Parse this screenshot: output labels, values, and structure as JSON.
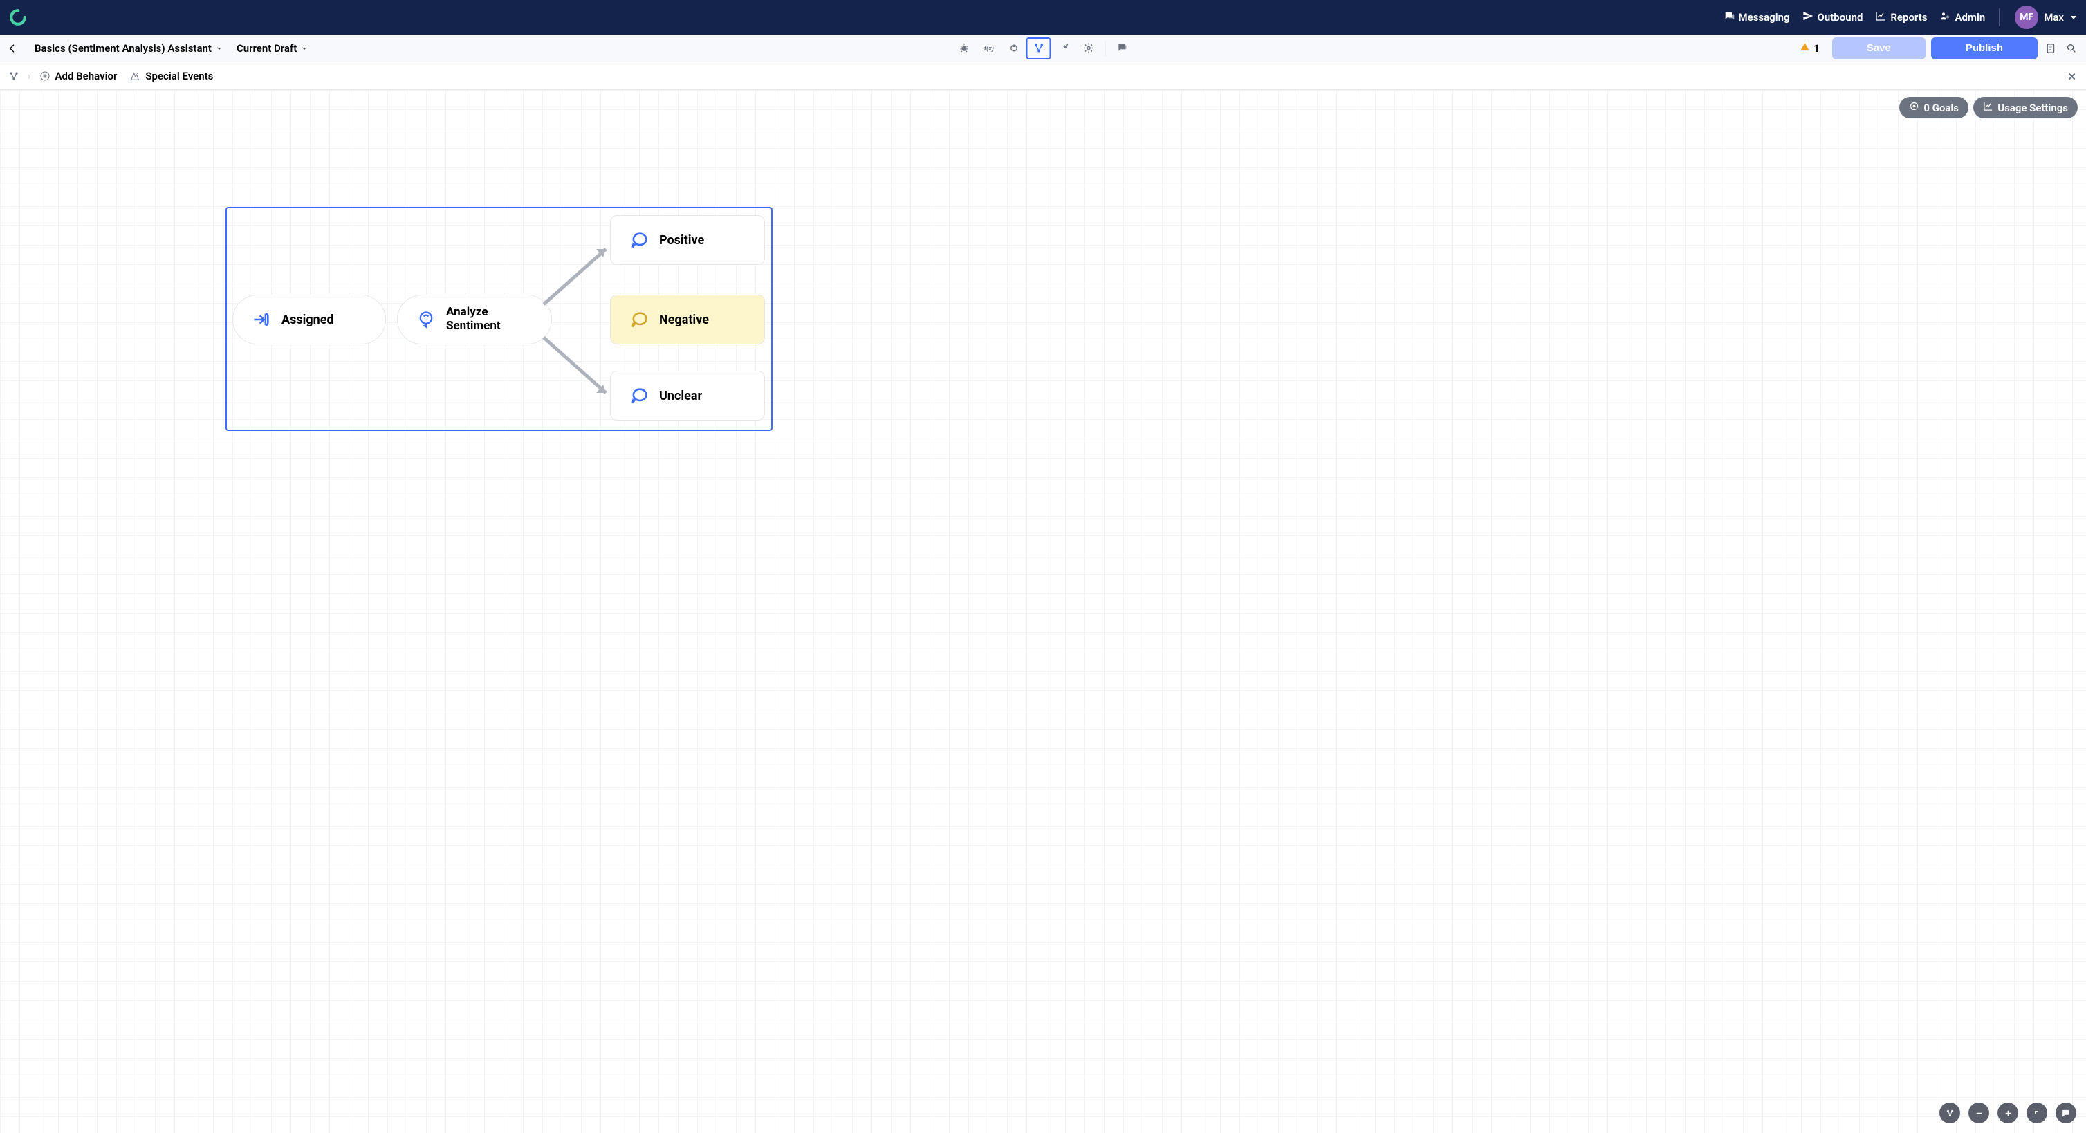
{
  "nav": {
    "messaging": "Messaging",
    "outbound": "Outbound",
    "reports": "Reports",
    "admin": "Admin",
    "user_initials": "MF",
    "user_name": "Max"
  },
  "breadcrumb": {
    "assistant": "Basics (Sentiment Analysis) Assistant",
    "draft": "Current Draft"
  },
  "toolbar": {
    "warnings": "1",
    "save": "Save",
    "publish": "Publish"
  },
  "strip": {
    "add_behavior": "Add Behavior",
    "special_events": "Special Events"
  },
  "canvas": {
    "goals_pill": "0 Goals",
    "usage_pill": "Usage Settings"
  },
  "nodes": {
    "assigned": "Assigned",
    "analyze_l1": "Analyze",
    "analyze_l2": "Sentiment",
    "positive": "Positive",
    "negative": "Negative",
    "unclear": "Unclear"
  }
}
